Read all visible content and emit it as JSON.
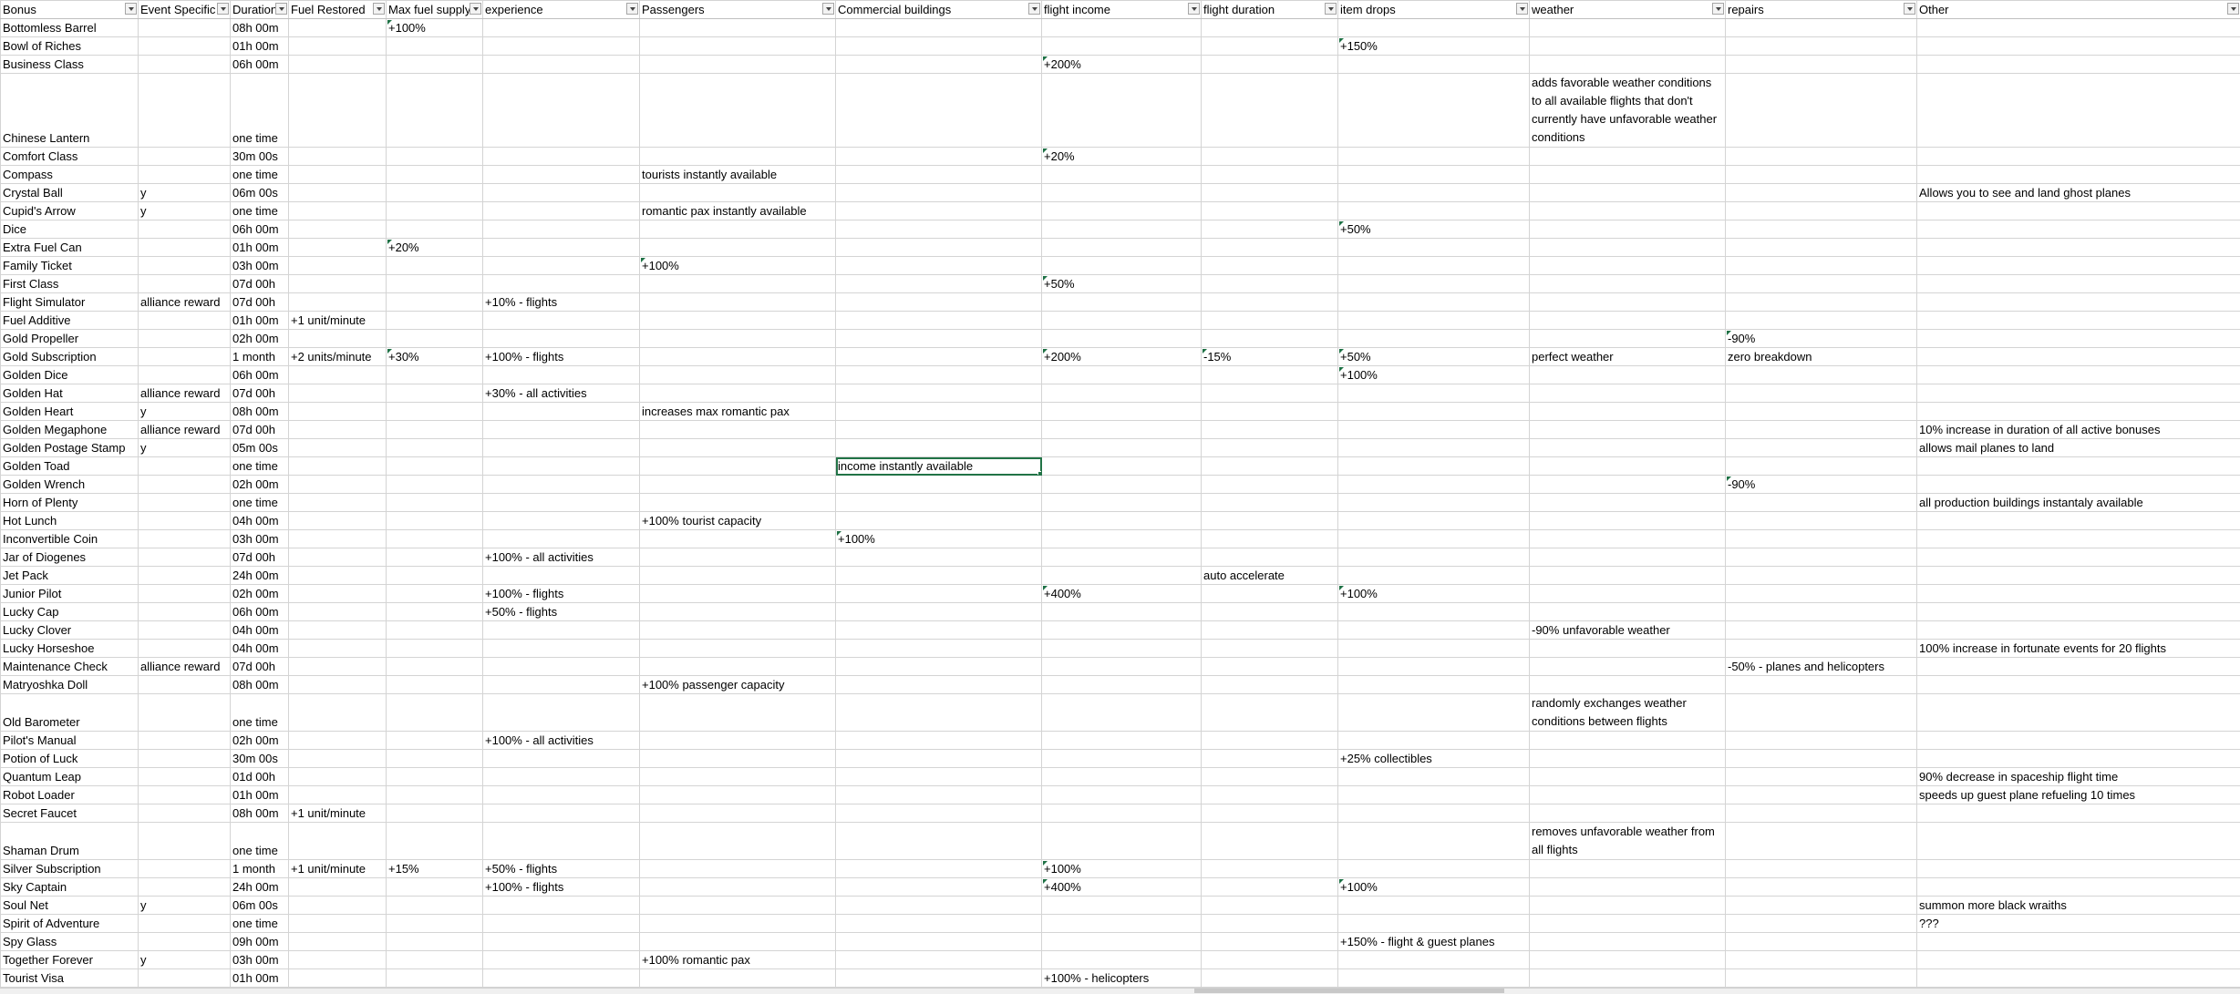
{
  "columns": [
    "Bonus",
    "Event Specific",
    "Duration",
    "Fuel Restored",
    "Max fuel supply",
    "experience",
    "Passengers",
    "Commercial buildings",
    "flight income",
    "flight duration",
    "item drops",
    "weather",
    "repairs",
    "Other"
  ],
  "rows": [
    {
      "c": [
        "Bottomless Barrel",
        "",
        "08h 00m",
        "",
        "+100%",
        "",
        "",
        "",
        "",
        "",
        "",
        "",
        "",
        ""
      ]
    },
    {
      "c": [
        "Bowl of Riches",
        "",
        "01h 00m",
        "",
        "",
        "",
        "",
        "",
        "",
        "",
        "+150%",
        "",
        "",
        ""
      ]
    },
    {
      "c": [
        "Business Class",
        "",
        "06h 00m",
        "",
        "",
        "",
        "",
        "",
        "+200%",
        "",
        "",
        "",
        "",
        ""
      ]
    },
    {
      "c": [
        "Chinese Lantern",
        "",
        "one time",
        "",
        "",
        "",
        "",
        "",
        "",
        "",
        "",
        "adds favorable weather conditions to all available flights that don't currently have unfavorable weather conditions",
        "",
        ""
      ],
      "tall": 4
    },
    {
      "c": [
        "Comfort Class",
        "",
        "30m 00s",
        "",
        "",
        "",
        "",
        "",
        "+20%",
        "",
        "",
        "",
        "",
        ""
      ]
    },
    {
      "c": [
        "Compass",
        "",
        "one time",
        "",
        "",
        "",
        "tourists instantly available",
        "",
        "",
        "",
        "",
        "",
        "",
        ""
      ]
    },
    {
      "c": [
        "Crystal Ball",
        "y",
        "06m 00s",
        "",
        "",
        "",
        "",
        "",
        "",
        "",
        "",
        "",
        "",
        "Allows you to see and land ghost planes"
      ]
    },
    {
      "c": [
        "Cupid's Arrow",
        "y",
        "one time",
        "",
        "",
        "",
        "romantic pax instantly available",
        "",
        "",
        "",
        "",
        "",
        "",
        ""
      ]
    },
    {
      "c": [
        "Dice",
        "",
        "06h 00m",
        "",
        "",
        "",
        "",
        "",
        "",
        "",
        "+50%",
        "",
        "",
        ""
      ]
    },
    {
      "c": [
        "Extra Fuel Can",
        "",
        "01h 00m",
        "",
        "+20%",
        "",
        "",
        "",
        "",
        "",
        "",
        "",
        "",
        ""
      ]
    },
    {
      "c": [
        "Family Ticket",
        "",
        "03h 00m",
        "",
        "",
        "",
        "+100%",
        "",
        "",
        "",
        "",
        "",
        "",
        ""
      ]
    },
    {
      "c": [
        "First Class",
        "",
        "07d 00h",
        "",
        "",
        "",
        "",
        "",
        "+50%",
        "",
        "",
        "",
        "",
        ""
      ]
    },
    {
      "c": [
        "Flight Simulator",
        "alliance reward",
        "07d 00h",
        "",
        "",
        "+10% - flights",
        "",
        "",
        "",
        "",
        "",
        "",
        "",
        ""
      ]
    },
    {
      "c": [
        "Fuel Additive",
        "",
        "01h 00m",
        "+1 unit/minute",
        "",
        "",
        "",
        "",
        "",
        "",
        "",
        "",
        "",
        ""
      ]
    },
    {
      "c": [
        "Gold Propeller",
        "",
        "02h 00m",
        "",
        "",
        "",
        "",
        "",
        "",
        "",
        "",
        "",
        "-90%",
        ""
      ]
    },
    {
      "c": [
        "Gold Subscription",
        "",
        "1 month",
        "+2 units/minute",
        "+30%",
        "+100% - flights",
        "",
        "",
        "+200%",
        "-15%",
        "+50%",
        "perfect weather",
        "zero breakdown",
        ""
      ]
    },
    {
      "c": [
        "Golden Dice",
        "",
        "06h 00m",
        "",
        "",
        "",
        "",
        "",
        "",
        "",
        "+100%",
        "",
        "",
        ""
      ]
    },
    {
      "c": [
        "Golden Hat",
        "alliance reward",
        "07d 00h",
        "",
        "",
        "+30% - all activities",
        "",
        "",
        "",
        "",
        "",
        "",
        "",
        ""
      ]
    },
    {
      "c": [
        "Golden Heart",
        "y",
        "08h 00m",
        "",
        "",
        "",
        "increases max romantic pax",
        "",
        "",
        "",
        "",
        "",
        "",
        ""
      ]
    },
    {
      "c": [
        "Golden Megaphone",
        "alliance reward",
        "07d 00h",
        "",
        "",
        "",
        "",
        "",
        "",
        "",
        "",
        "",
        "",
        "10% increase in duration of all active bonuses"
      ]
    },
    {
      "c": [
        "Golden Postage Stamp",
        "y",
        "05m 00s",
        "",
        "",
        "",
        "",
        "",
        "",
        "",
        "",
        "",
        "",
        "allows mail planes to land"
      ]
    },
    {
      "c": [
        "Golden Toad",
        "",
        "one time",
        "",
        "",
        "",
        "",
        "income instantly available",
        "",
        "",
        "",
        "",
        "",
        ""
      ]
    },
    {
      "c": [
        "Golden Wrench",
        "",
        "02h 00m",
        "",
        "",
        "",
        "",
        "",
        "",
        "",
        "",
        "",
        "-90%",
        ""
      ]
    },
    {
      "c": [
        "Horn of Plenty",
        "",
        "one time",
        "",
        "",
        "",
        "",
        "",
        "",
        "",
        "",
        "",
        "",
        "all production buildings instantaly available"
      ]
    },
    {
      "c": [
        "Hot Lunch",
        "",
        "04h 00m",
        "",
        "",
        "",
        "+100% tourist capacity",
        "",
        "",
        "",
        "",
        "",
        "",
        ""
      ]
    },
    {
      "c": [
        "Inconvertible Coin",
        "",
        "03h 00m",
        "",
        "",
        "",
        "",
        "+100%",
        "",
        "",
        "",
        "",
        "",
        ""
      ]
    },
    {
      "c": [
        "Jar of Diogenes",
        "",
        "07d 00h",
        "",
        "",
        "+100% - all activities",
        "",
        "",
        "",
        "",
        "",
        "",
        "",
        ""
      ]
    },
    {
      "c": [
        "Jet Pack",
        "",
        "24h 00m",
        "",
        "",
        "",
        "",
        "",
        "",
        "auto accelerate",
        "",
        "",
        "",
        ""
      ]
    },
    {
      "c": [
        "Junior Pilot",
        "",
        "02h 00m",
        "",
        "",
        "+100% - flights",
        "",
        "",
        "+400%",
        "",
        "+100%",
        "",
        "",
        ""
      ]
    },
    {
      "c": [
        "Lucky Cap",
        "",
        "06h 00m",
        "",
        "",
        "+50% - flights",
        "",
        "",
        "",
        "",
        "",
        "",
        "",
        ""
      ]
    },
    {
      "c": [
        "Lucky Clover",
        "",
        "04h 00m",
        "",
        "",
        "",
        "",
        "",
        "",
        "",
        "",
        "-90% unfavorable weather",
        "",
        ""
      ]
    },
    {
      "c": [
        "Lucky Horseshoe",
        "",
        "04h 00m",
        "",
        "",
        "",
        "",
        "",
        "",
        "",
        "",
        "",
        "",
        "100% increase in fortunate events for 20 flights"
      ]
    },
    {
      "c": [
        "Maintenance Check",
        "alliance reward",
        "07d 00h",
        "",
        "",
        "",
        "",
        "",
        "",
        "",
        "",
        "",
        "-50% - planes and helicopters",
        ""
      ]
    },
    {
      "c": [
        "Matryoshka Doll",
        "",
        "08h 00m",
        "",
        "",
        "",
        "+100% passenger capacity",
        "",
        "",
        "",
        "",
        "",
        "",
        ""
      ]
    },
    {
      "c": [
        "Old Barometer",
        "",
        "one time",
        "",
        "",
        "",
        "",
        "",
        "",
        "",
        "",
        "randomly exchanges weather conditions between flights",
        "",
        ""
      ],
      "tall": 2
    },
    {
      "c": [
        "Pilot's Manual",
        "",
        "02h 00m",
        "",
        "",
        "+100% - all activities",
        "",
        "",
        "",
        "",
        "",
        "",
        "",
        ""
      ]
    },
    {
      "c": [
        "Potion of Luck",
        "",
        "30m 00s",
        "",
        "",
        "",
        "",
        "",
        "",
        "",
        "+25% collectibles",
        "",
        "",
        ""
      ]
    },
    {
      "c": [
        "Quantum Leap",
        "",
        "01d 00h",
        "",
        "",
        "",
        "",
        "",
        "",
        "",
        "",
        "",
        "",
        "90% decrease in spaceship flight time"
      ]
    },
    {
      "c": [
        "Robot Loader",
        "",
        "01h 00m",
        "",
        "",
        "",
        "",
        "",
        "",
        "",
        "",
        "",
        "",
        "speeds up guest plane refueling 10 times"
      ]
    },
    {
      "c": [
        "Secret Faucet",
        "",
        "08h 00m",
        "+1 unit/minute",
        "",
        "",
        "",
        "",
        "",
        "",
        "",
        "",
        "",
        ""
      ]
    },
    {
      "c": [
        "Shaman Drum",
        "",
        "one time",
        "",
        "",
        "",
        "",
        "",
        "",
        "",
        "",
        "removes unfavorable weather from all flights",
        "",
        ""
      ],
      "tall": 2
    },
    {
      "c": [
        "Silver Subscription",
        "",
        "1 month",
        "+1 unit/minute",
        "+15%",
        "+50% - flights",
        "",
        "",
        "+100%",
        "",
        "",
        "",
        "",
        ""
      ]
    },
    {
      "c": [
        "Sky Captain",
        "",
        "24h 00m",
        "",
        "",
        "+100% - flights",
        "",
        "",
        "+400%",
        "",
        "+100%",
        "",
        "",
        ""
      ]
    },
    {
      "c": [
        "Soul Net",
        "y",
        "06m 00s",
        "",
        "",
        "",
        "",
        "",
        "",
        "",
        "",
        "",
        "",
        "summon more black wraiths"
      ]
    },
    {
      "c": [
        "Spirit of Adventure",
        "",
        "one time",
        "",
        "",
        "",
        "",
        "",
        "",
        "",
        "",
        "",
        "",
        "???"
      ]
    },
    {
      "c": [
        "Spy Glass",
        "",
        "09h 00m",
        "",
        "",
        "",
        "",
        "",
        "",
        "",
        "+150% - flight & guest planes",
        "",
        "",
        ""
      ]
    },
    {
      "c": [
        "Together Forever",
        "y",
        "03h 00m",
        "",
        "",
        "",
        "+100%  romantic pax",
        "",
        "",
        "",
        "",
        "",
        "",
        ""
      ]
    },
    {
      "c": [
        "Tourist Visa",
        "",
        "01h 00m",
        "",
        "",
        "",
        "",
        "",
        "+100% - helicopters",
        "",
        "",
        "",
        "",
        ""
      ]
    }
  ],
  "markers": [
    [
      0,
      4
    ],
    [
      1,
      10
    ],
    [
      2,
      8
    ],
    [
      4,
      8
    ],
    [
      8,
      10
    ],
    [
      9,
      4
    ],
    [
      10,
      6
    ],
    [
      11,
      8
    ],
    [
      14,
      12
    ],
    [
      15,
      4
    ],
    [
      15,
      8
    ],
    [
      15,
      9
    ],
    [
      15,
      10
    ],
    [
      16,
      10
    ],
    [
      22,
      12
    ],
    [
      25,
      7
    ],
    [
      28,
      8
    ],
    [
      28,
      10
    ],
    [
      41,
      8
    ],
    [
      42,
      8
    ],
    [
      42,
      10
    ]
  ],
  "selected": [
    21,
    7
  ]
}
